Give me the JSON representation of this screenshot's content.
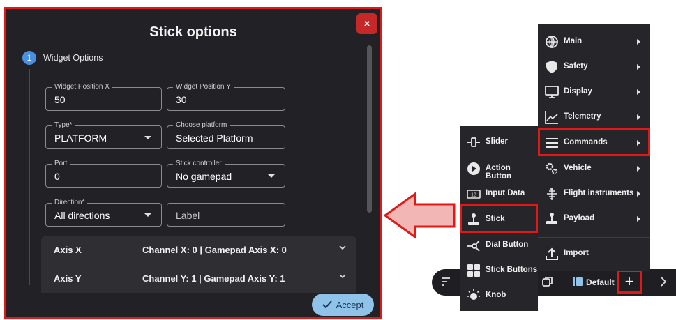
{
  "dialog": {
    "title": "Stick options",
    "close_label": "×",
    "step_number": "1",
    "step_label": "Widget Options",
    "fields": {
      "pos_x": {
        "label": "Widget Position X",
        "value": "50"
      },
      "pos_y": {
        "label": "Widget Position Y",
        "value": "30"
      },
      "type": {
        "label": "Type*",
        "value": "PLATFORM"
      },
      "platform": {
        "label": "Choose platform",
        "value": "Selected Platform"
      },
      "port": {
        "label": "Port",
        "value": "0"
      },
      "controller": {
        "label": "Stick controller",
        "value": "No gamepad"
      },
      "direction": {
        "label": "Direction*",
        "value": "All directions"
      },
      "label_placeholder": "Label"
    },
    "axes": [
      {
        "name": "Axis X",
        "desc": "Channel X: 0 | Gamepad Axis X: 0"
      },
      {
        "name": "Axis Y",
        "desc": "Channel Y: 1 | Gamepad Axis Y: 1"
      }
    ],
    "accept_label": "Accept"
  },
  "main_menu": {
    "items": [
      {
        "label": "Main",
        "icon": "globe-icon"
      },
      {
        "label": "Safety",
        "icon": "shield-icon"
      },
      {
        "label": "Display",
        "icon": "monitor-icon"
      },
      {
        "label": "Telemetry",
        "icon": "line-chart-icon"
      },
      {
        "label": "Commands",
        "icon": "hamburger-lines-icon"
      },
      {
        "label": "Vehicle",
        "icon": "gears-icon"
      },
      {
        "label": "Flight instruments",
        "icon": "attitude-icon"
      },
      {
        "label": "Payload",
        "icon": "joystick-icon"
      },
      {
        "label": "Import",
        "icon": "upload-icon"
      }
    ]
  },
  "commands_menu": {
    "items": [
      {
        "label": "Slider",
        "icon": "slider-icon"
      },
      {
        "label": "Action Button",
        "icon": "play-circle-icon"
      },
      {
        "label": "Input Data",
        "icon": "number-input-icon"
      },
      {
        "label": "Stick",
        "icon": "joystick-icon"
      },
      {
        "label": "Dial Button",
        "icon": "dial-icon"
      },
      {
        "label": "Stick Buttons",
        "icon": "grid-icon"
      },
      {
        "label": "Knob",
        "icon": "knob-icon"
      }
    ]
  },
  "toolbar": {
    "profile_label": "Default",
    "plus_label": "+"
  },
  "colors": {
    "highlight": "#e01818",
    "dialog_bg": "#222226",
    "accept_bg": "#8fc3ea",
    "arrow_fill": "#f2b7b4"
  }
}
